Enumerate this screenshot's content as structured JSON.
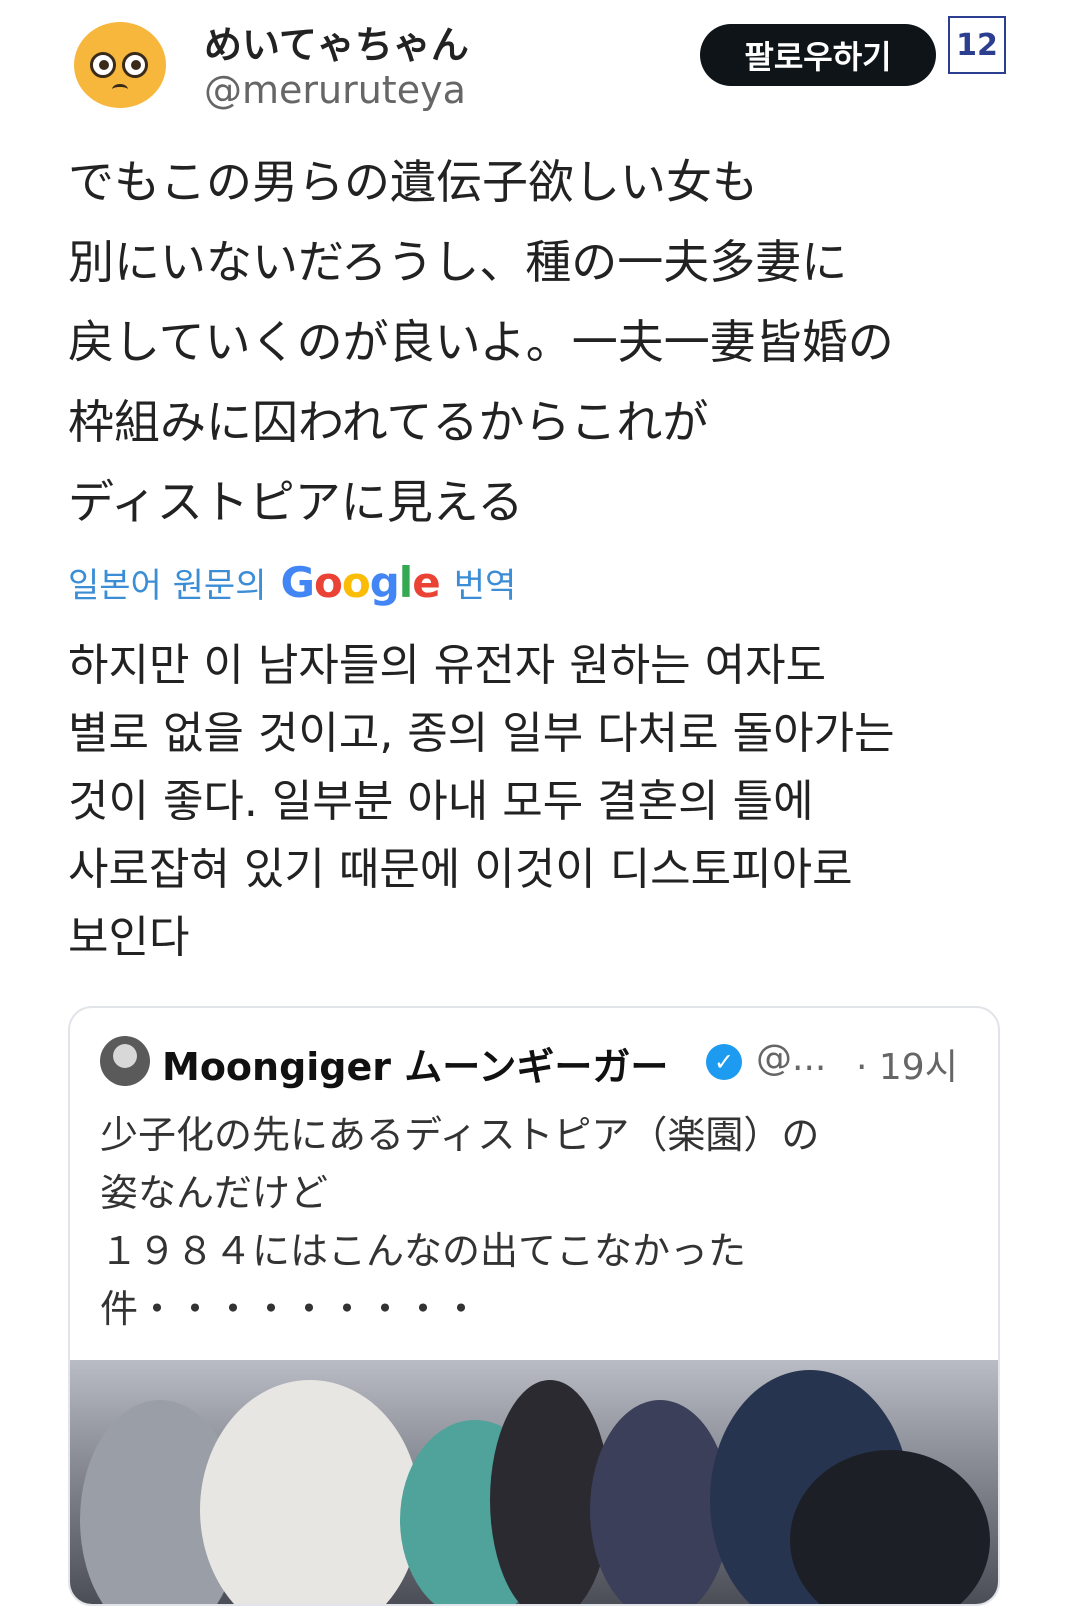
{
  "header": {
    "display_name": "めいてゃちゃん",
    "handle": "@meruruteya",
    "follow_label": "팔로우하기",
    "page_number": "12"
  },
  "tweet": {
    "original_lines": [
      "でもこの男らの遺伝子欲しい女も",
      "別にいないだろうし、種の一夫多妻に",
      "戻していくのが良いよ。一夫一妻皆婚の",
      "枠組みに囚われてるからこれが",
      "ディストピアに見える"
    ],
    "translation": {
      "prefix": "일본어 원문의",
      "logo_letters": [
        "G",
        "o",
        "o",
        "g",
        "l",
        "e"
      ],
      "suffix": "번역"
    },
    "translated_lines": [
      "하지만 이 남자들의 유전자 원하는 여자도",
      "별로 없을 것이고, 종의 일부 다처로 돌아가는",
      "것이 좋다. 일부분 아내 모두 결혼의 틀에",
      "사로잡혀 있기 때문에 이것이 디스토피아로",
      "보인다"
    ]
  },
  "quoted": {
    "name": "Moongiger ムーンギーガー",
    "verified_glyph": "✓",
    "handle": "@...",
    "time": "· 19시",
    "lines": [
      "少子化の先にあるディストピア（楽園）の",
      "姿なんだけど",
      "１９８４にはこんなの出てこなかった",
      "件・・・・・・・・・"
    ]
  },
  "icons": {
    "avatar": "pleading-face-icon",
    "verified": "verified-badge-icon"
  },
  "colors": {
    "follow_button": "#0f1419",
    "translate_link": "#3b8ed6",
    "verified": "#1d9bf0",
    "page_badge": "#2c3e8f"
  }
}
